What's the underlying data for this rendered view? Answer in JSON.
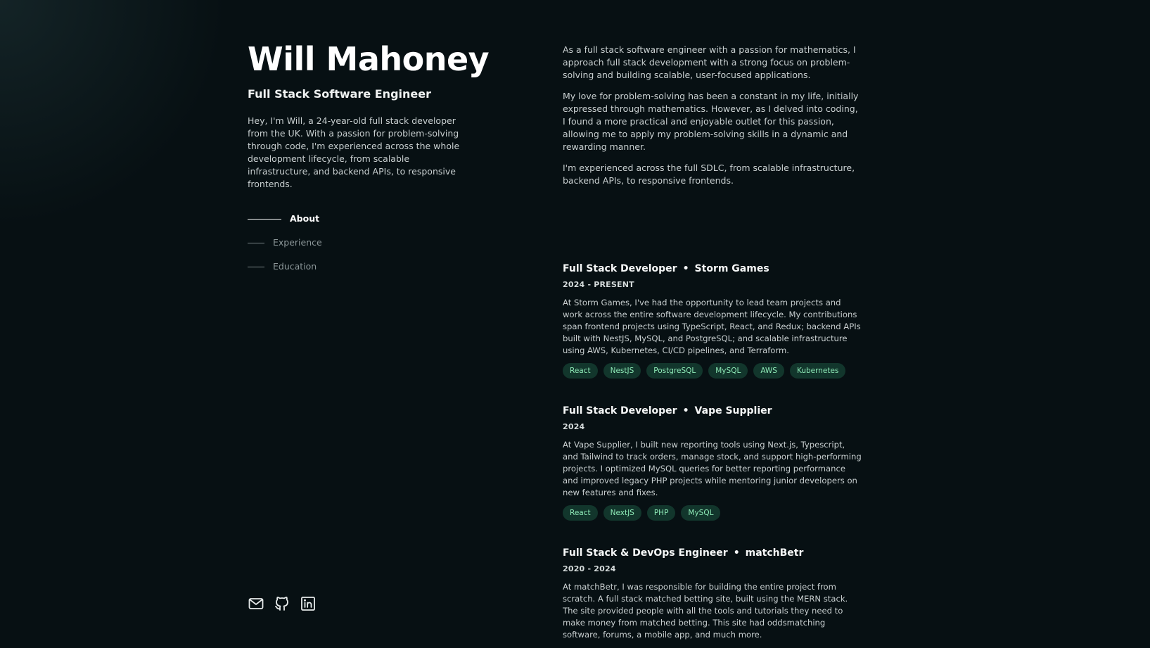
{
  "profile": {
    "name": "Will Mahoney",
    "role": "Full Stack Software Engineer",
    "intro": "Hey, I'm Will, a 24-year-old full stack developer from the UK. With a passion for problem-solving through code, I'm experienced across the whole development lifecycle, from scalable infrastructure, and backend APIs, to responsive frontends."
  },
  "nav": {
    "about": "About",
    "experience": "Experience",
    "education": "Education"
  },
  "social": {
    "email_icon": "mail-icon",
    "github_icon": "github-icon",
    "linkedin_icon": "linkedin-icon"
  },
  "about": {
    "paragraphs": [
      "As a full stack software engineer with a passion for mathematics, I approach full stack development with a strong focus on problem-solving and building scalable, user-focused applications.",
      "My love for problem-solving has been a constant in my life, initially expressed through mathematics. However, as I delved into coding, I found a more practical and enjoyable outlet for this passion, allowing me to apply my problem-solving skills in a dynamic and rewarding manner.",
      "I'm experienced across the full SDLC, from scalable infrastructure, backend APIs, to responsive frontends."
    ]
  },
  "experience": [
    {
      "title": "Full Stack Developer",
      "company": "Storm Games",
      "date": "2024 - PRESENT",
      "description": "At Storm Games, I've had the opportunity to lead team projects and work across the entire software development lifecycle. My contributions span frontend projects using TypeScript, React, and Redux; backend APIs built with NestJS, MySQL, and PostgreSQL; and scalable infrastructure using AWS, Kubernetes, CI/CD pipelines, and Terraform.",
      "tags": [
        "React",
        "NestJS",
        "PostgreSQL",
        "MySQL",
        "AWS",
        "Kubernetes"
      ]
    },
    {
      "title": "Full Stack Developer",
      "company": "Vape Supplier",
      "date": "2024",
      "description": "At Vape Supplier, I built new reporting tools using Next.js, Typescript, and Tailwind to track orders, manage stock, and support high-performing projects. I optimized MySQL queries for better reporting performance and improved legacy PHP projects while mentoring junior developers on new features and fixes.",
      "tags": [
        "React",
        "NextJS",
        "PHP",
        "MySQL"
      ]
    },
    {
      "title": "Full Stack & DevOps Engineer",
      "company": "matchBetr",
      "date": "2020 - 2024",
      "description": "At matchBetr, I was responsible for building the entire project from scratch. A full stack matched betting site, built using the MERN stack. The site provided people with all the tools and tutorials they need to make money from matched betting. This site had oddsmatching software, forums, a mobile app, and much more.",
      "tags": []
    }
  ],
  "theme": {
    "background": "#071013",
    "accent_tag_bg": "#12362c",
    "accent_tag_text": "#8eeab7"
  },
  "separator": "•"
}
